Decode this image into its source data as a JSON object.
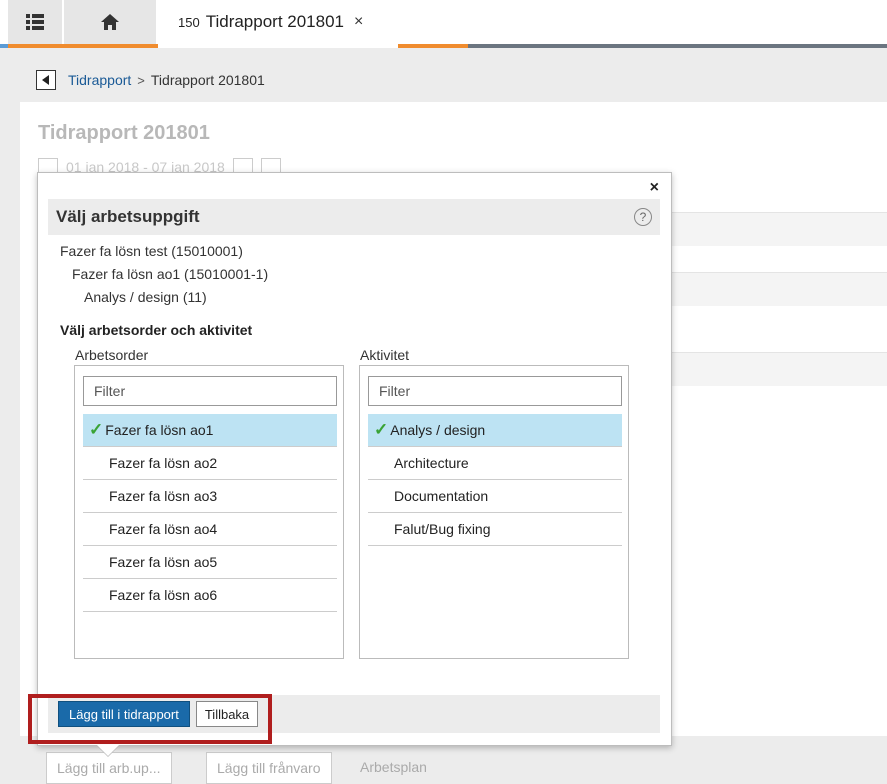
{
  "tabs": {
    "active_number": "150",
    "active_title": "Tidrapport 201801",
    "close_glyph": "×",
    "menu_icon": "grid-menu-icon",
    "home_icon": "home-icon"
  },
  "breadcrumb": {
    "link": "Tidrapport",
    "separator": ">",
    "current": "Tidrapport 201801"
  },
  "background": {
    "title": "Tidrapport 201801",
    "date_range": "01 jan 2018 - 07 jan 2018",
    "bottom_buttons": [
      "Lägg till arb.up...",
      "Lägg till frånvaro"
    ],
    "bottom_text": "Arbetsplan"
  },
  "dialog": {
    "close_glyph": "×",
    "title": "Välj arbetsuppgift",
    "help_glyph": "?",
    "path": [
      "Fazer fa lösn test (15010001)",
      "Fazer fa lösn ao1 (15010001-1)",
      "Analys / design (11)"
    ],
    "section_label": "Välj arbetsorder och aktivitet",
    "left": {
      "label": "Arbetsorder",
      "filter_placeholder": "Filter",
      "items": [
        "Fazer fa lösn ao1",
        "Fazer fa lösn ao2",
        "Fazer fa lösn ao3",
        "Fazer fa lösn ao4",
        "Fazer fa lösn ao5",
        "Fazer fa lösn ao6"
      ],
      "selected_index": 0
    },
    "right": {
      "label": "Aktivitet",
      "filter_placeholder": "Filter",
      "items": [
        "Analys / design",
        "Architecture",
        "Documentation",
        "Falut/Bug fixing"
      ],
      "selected_index": 0
    },
    "primary_button": "Lägg till i tidrapport",
    "secondary_button": "Tillbaka"
  },
  "colors": {
    "accent_orange": "#f08c2e",
    "primary_blue": "#1a6aa9",
    "selected_row": "#bde3f3",
    "highlight_red": "#b01e1e",
    "check_green": "#3aa335"
  }
}
